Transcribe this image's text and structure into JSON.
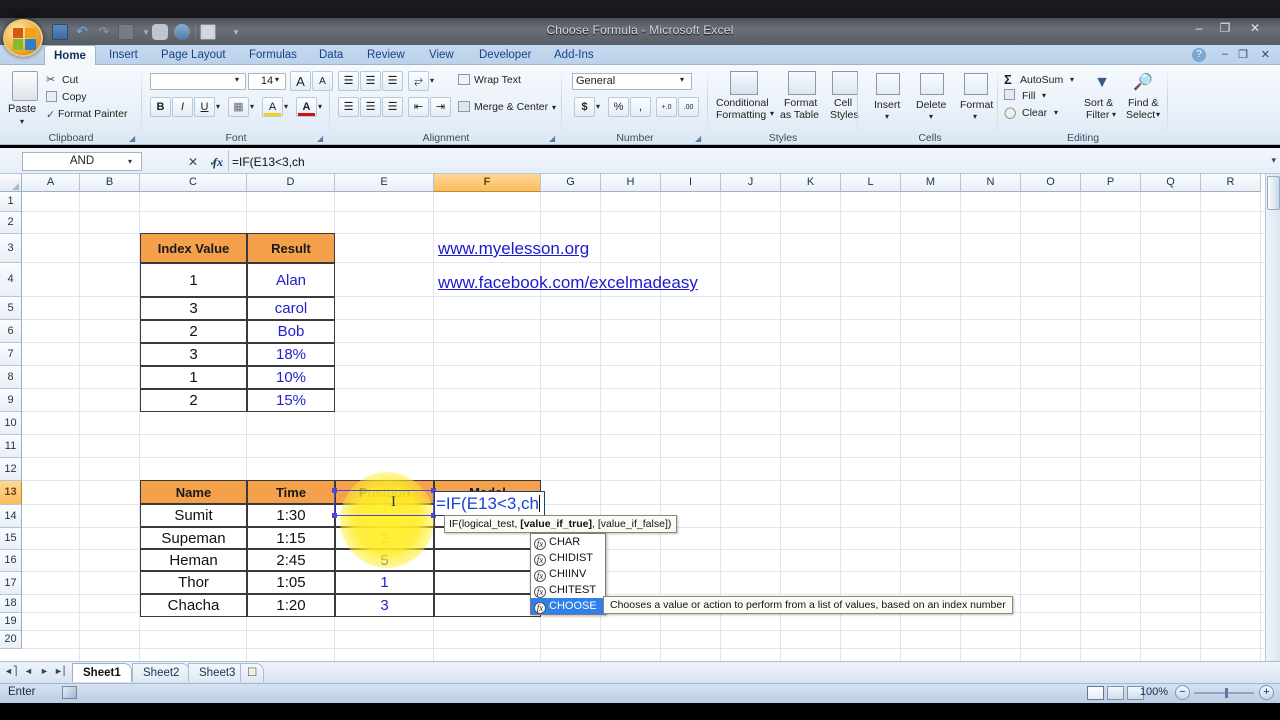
{
  "window": {
    "title": "Choose Formula - Microsoft Excel",
    "minimize": "–",
    "restore": "❐",
    "close": "✕",
    "help_icon": "?"
  },
  "quick_access": {
    "items": [
      {
        "name": "save-icon",
        "glyph": "💾"
      },
      {
        "name": "undo-icon",
        "glyph": "↶"
      },
      {
        "name": "redo-icon",
        "glyph": "↷"
      },
      {
        "name": "print-preview-icon",
        "glyph": "❐"
      },
      {
        "name": "dropdown-icon",
        "glyph": "▾"
      },
      {
        "name": "comment-icon",
        "glyph": "●"
      },
      {
        "name": "glasses-icon",
        "glyph": "◑"
      },
      {
        "name": "sheet-icon",
        "glyph": "▧"
      },
      {
        "name": "customize-qat-icon",
        "glyph": "▾"
      }
    ]
  },
  "ribbon": {
    "tabs": [
      {
        "label": "Home",
        "active": true
      },
      {
        "label": "Insert",
        "active": false
      },
      {
        "label": "Page Layout",
        "active": false
      },
      {
        "label": "Formulas",
        "active": false
      },
      {
        "label": "Data",
        "active": false
      },
      {
        "label": "Review",
        "active": false
      },
      {
        "label": "View",
        "active": false
      },
      {
        "label": "Developer",
        "active": false
      },
      {
        "label": "Add-Ins",
        "active": false
      }
    ],
    "groups": {
      "clipboard": {
        "label": "Clipboard",
        "paste": "Paste",
        "cut": "Cut",
        "copy": "Copy",
        "format_painter": "Format Painter"
      },
      "font": {
        "label": "Font",
        "font_name": "",
        "font_size": "14",
        "grow_font": "A",
        "shrink_font": "A",
        "bold": "B",
        "italic": "I",
        "underline": "U",
        "borders": "▦",
        "fill_color": "A",
        "font_color": "A"
      },
      "alignment": {
        "label": "Alignment",
        "wrap_text": "Wrap Text",
        "merge_center": "Merge & Center"
      },
      "number": {
        "label": "Number",
        "format_value": "General",
        "currency": "$",
        "percent": "%",
        "comma": ",",
        "increase_decimal": "+.0",
        "decrease_decimal": ".00"
      },
      "styles": {
        "label": "Styles",
        "conditional_formatting": "Conditional\nFormatting",
        "conditional_formatting_l1": "Conditional",
        "conditional_formatting_l2": "Formatting",
        "format_as_table_l1": "Format",
        "format_as_table_l2": "as Table",
        "cell_styles_l1": "Cell",
        "cell_styles_l2": "Styles"
      },
      "cells": {
        "label": "Cells",
        "insert": "Insert",
        "delete": "Delete",
        "format": "Format"
      },
      "editing": {
        "label": "Editing",
        "autosum": "AutoSum",
        "fill": "Fill",
        "clear": "Clear",
        "sort_filter_l1": "Sort &",
        "sort_filter_l2": "Filter",
        "find_select_l1": "Find &",
        "find_select_l2": "Select"
      }
    }
  },
  "formula_bar": {
    "name_box": "AND",
    "cancel_icon": "✕",
    "enter_icon": "✓",
    "insert_function_icon": "fx",
    "formula": "=IF(E13<3,ch"
  },
  "grid": {
    "columns": [
      "A",
      "B",
      "C",
      "D",
      "E",
      "F",
      "G",
      "H",
      "I",
      "J",
      "K",
      "L",
      "M",
      "N",
      "O",
      "P",
      "Q",
      "R"
    ],
    "selected_column": "F",
    "rows": [
      "1",
      "2",
      "3",
      "4",
      "5",
      "6",
      "7",
      "8",
      "9",
      "10",
      "11",
      "12",
      "13",
      "14",
      "15",
      "16",
      "17",
      "18",
      "19",
      "20"
    ],
    "selected_row": "13",
    "active_cell": "F13"
  },
  "table_index": {
    "headers": [
      "Index Value",
      "Result"
    ],
    "rows": [
      {
        "index": "1",
        "result": "Alan"
      },
      {
        "index": "3",
        "result": "carol"
      },
      {
        "index": "2",
        "result": "Bob"
      },
      {
        "index": "3",
        "result": "18%"
      },
      {
        "index": "1",
        "result": "10%"
      },
      {
        "index": "2",
        "result": "15%"
      }
    ]
  },
  "links": [
    "www.myelesson.org",
    "www.facebook.com/excelmadeasy"
  ],
  "table_race": {
    "headers": [
      "Name",
      "Time",
      "Position",
      "Medal"
    ],
    "rows": [
      {
        "name": "Sumit",
        "time": "1:30",
        "position": "",
        "medal": ""
      },
      {
        "name": "Supeman",
        "time": "1:15",
        "position": "2",
        "medal": ""
      },
      {
        "name": "Heman",
        "time": "2:45",
        "position": "5",
        "medal": ""
      },
      {
        "name": "Thor",
        "time": "1:05",
        "position": "1",
        "medal": ""
      },
      {
        "name": "Chacha",
        "time": "1:20",
        "position": "3",
        "medal": ""
      }
    ]
  },
  "cell_editor": {
    "text": "=IF(E13<3,ch"
  },
  "function_tip": {
    "prefix": "IF(logical_test, ",
    "bold": "[value_if_true]",
    "suffix": ", [value_if_false])"
  },
  "autocomplete": {
    "items": [
      {
        "label": "CHAR",
        "selected": false
      },
      {
        "label": "CHIDIST",
        "selected": false
      },
      {
        "label": "CHIINV",
        "selected": false
      },
      {
        "label": "CHITEST",
        "selected": false
      },
      {
        "label": "CHOOSE",
        "selected": true
      }
    ],
    "description": "Chooses a value or action to perform from a list of values, based on an index number"
  },
  "sheets": {
    "first_icon": "⏮",
    "prev_icon": "◀",
    "next_icon": "▶",
    "last_icon": "⏭",
    "tabs": [
      {
        "label": "Sheet1",
        "active": true
      },
      {
        "label": "Sheet2",
        "active": false
      },
      {
        "label": "Sheet3",
        "active": false
      }
    ],
    "insert_sheet_icon": "➕"
  },
  "status_bar": {
    "mode": "Enter",
    "zoom": "100%",
    "zoom_out": "−",
    "zoom_in": "+",
    "views": [
      "normal-view",
      "page-layout-view",
      "page-break-view"
    ]
  },
  "colors": {
    "header_orange": "#f5a04b",
    "link_blue": "#1a1ad0",
    "value_blue": "#2222cc",
    "selection_highlight": "#ffec28",
    "accent": "#15428b"
  }
}
